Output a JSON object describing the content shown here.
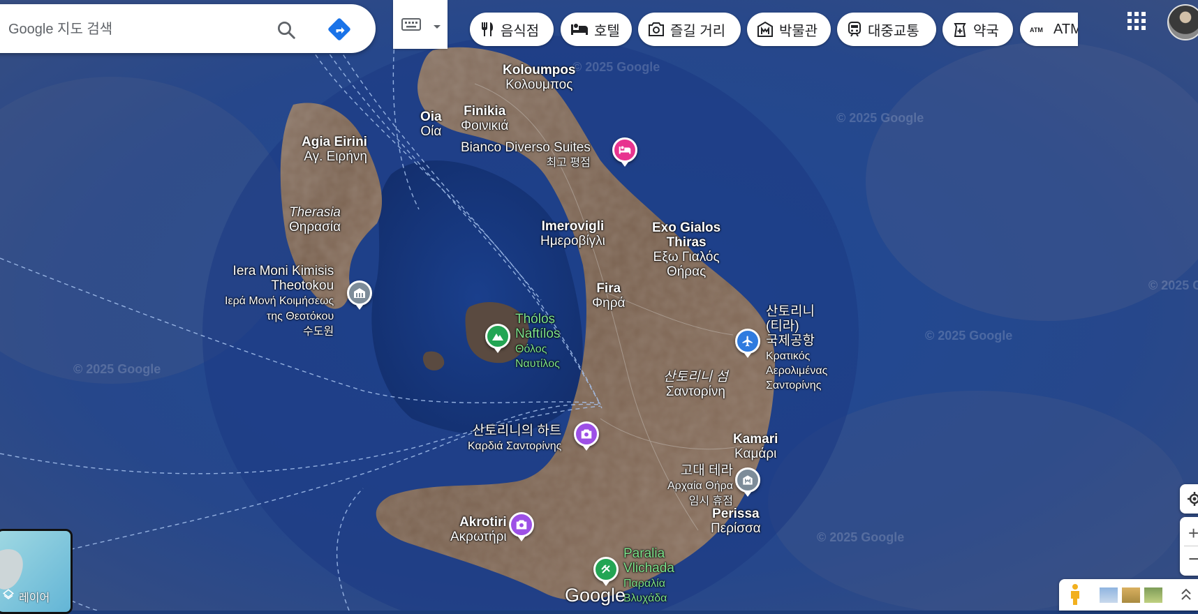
{
  "search": {
    "placeholder": "Google 지도 검색"
  },
  "categories": [
    {
      "label": "음식점",
      "icon": "fork-knife-icon"
    },
    {
      "label": "호텔",
      "icon": "bed-icon"
    },
    {
      "label": "즐길 거리",
      "icon": "camera-icon"
    },
    {
      "label": "박물관",
      "icon": "museum-icon"
    },
    {
      "label": "대중교통",
      "icon": "train-icon"
    },
    {
      "label": "약국",
      "icon": "pharmacy-icon"
    },
    {
      "label": "ATM",
      "icon": "atm-icon"
    }
  ],
  "places": {
    "koloumpos": [
      "Koloumpos",
      "Κολουμπος"
    ],
    "oia": [
      "Oia",
      "Οία"
    ],
    "finikia": [
      "Finikia",
      "Φοινικιά"
    ],
    "bianco": [
      "Bianco Diverso Suites",
      "최고 평점"
    ],
    "agia_eirini": [
      "Agia Eirini",
      "Αγ. Ειρήνη"
    ],
    "therasia": [
      "Therasia",
      "Θηρασία"
    ],
    "imerovigli": [
      "Imerovigli",
      "Ημεροβίγλι"
    ],
    "exo_gialos": [
      "Exo Gialos",
      "Thiras",
      "Εξω Γιαλός",
      "Θήρας"
    ],
    "iera_moni": [
      "Iera Moni Kimisis",
      "Theotokou",
      "Ιερά Μονή Κοιμήσεως",
      "της Θεοτόκου",
      "수도원"
    ],
    "fira": [
      "Fira",
      "Φηρά"
    ],
    "tholos": [
      "Thólos",
      "Naftílos",
      "Θόλος",
      "Ναυτίλος"
    ],
    "airport": [
      "산토리니",
      "(티라)",
      "국제공항",
      "Κρατικός",
      "Αερολιμένας",
      "Σαντορίνης"
    ],
    "santorini_island": [
      "산토리니 섬",
      "Σαντορίνη"
    ],
    "heart": [
      "산토리니의 하트",
      "Καρδιά Σαντορίνης"
    ],
    "kamari": [
      "Kamari",
      "Καμάρι"
    ],
    "ancient_thera": [
      "고대 테라",
      "Αρχαία Θήρα",
      "임시 휴점"
    ],
    "perissa": [
      "Perissa",
      "Περίσσα"
    ],
    "akrotiri": [
      "Akrotiri",
      "Ακρωτήρι"
    ],
    "vlichada": [
      "Paralia",
      "Vlichada",
      "Παραλία",
      "Βλυχάδα"
    ]
  },
  "watermark": "© 2025 Google",
  "google_logo": "Google",
  "layers_label": "레이어",
  "colors": {
    "hotel": "#e8348f",
    "attraction": "#9d50e6",
    "nature": "#23a554",
    "airport": "#2f7bdf",
    "landmark": "#7d8c99",
    "sea": "#1d3d7a"
  }
}
